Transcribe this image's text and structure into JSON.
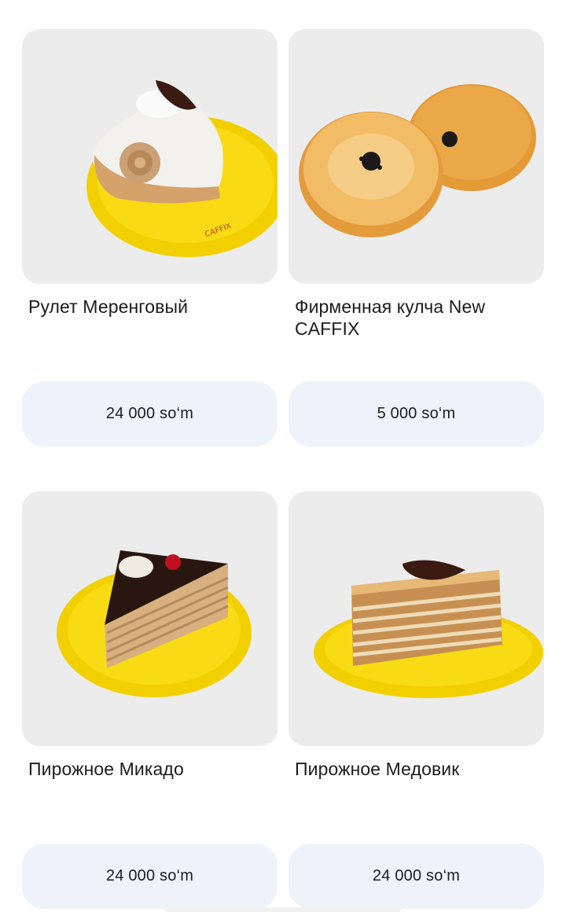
{
  "products": [
    {
      "name": "Рулет Меренговый",
      "price": "24 000 so‘m",
      "image_icon": "meringue-roll-image",
      "plate_text": "CAFFIX"
    },
    {
      "name": "Фирменная кулча New CAFFIX",
      "price": "5 000 so‘m",
      "image_icon": "kulcha-bread-image"
    },
    {
      "name": "Пирожное Микадо",
      "price": "24 000 so‘m",
      "image_icon": "mikado-cake-image"
    },
    {
      "name": "Пирожное Медовик",
      "price": "24 000 so‘m",
      "image_icon": "medovik-cake-image"
    }
  ],
  "colors": {
    "card_bg": "#ececec",
    "price_button_bg": "#eef2fb",
    "plate_yellow": "#f5d400",
    "text": "#1c1c1e"
  }
}
